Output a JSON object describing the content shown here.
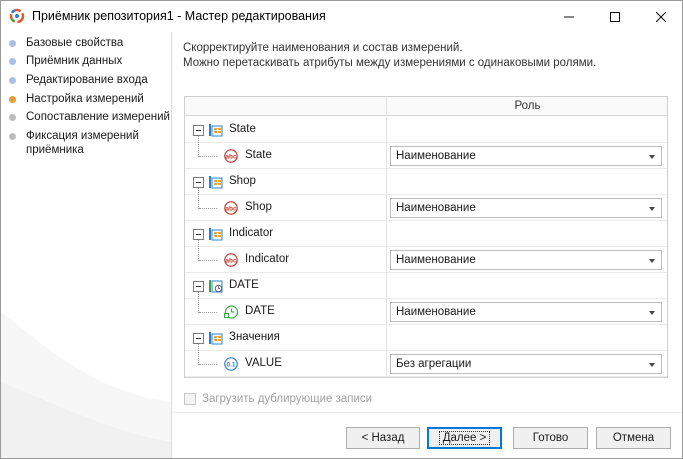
{
  "window": {
    "title": "Приёмник репозитория1 - Мастер редактирования"
  },
  "sidebar": {
    "steps": [
      {
        "label": "Базовые свойства",
        "state": "done"
      },
      {
        "label": "Приёмник данных",
        "state": "done"
      },
      {
        "label": "Редактирование входа",
        "state": "done"
      },
      {
        "label": "Настройка измерений",
        "state": "active"
      },
      {
        "label": "Сопоставление измерений",
        "state": "todo"
      },
      {
        "label": "Фиксация измерений приёмника",
        "state": "todo"
      }
    ]
  },
  "main": {
    "description_line1": "Скорректируйте наименования и состав измерений.",
    "description_line2": "Можно перетаскивать атрибуты между измерениями с одинаковыми ролями.",
    "grid": {
      "role_header": "Роль",
      "groups": [
        {
          "name": "State",
          "icon": "dimension-icon",
          "attribute": "State",
          "attribute_icon": "text-attribute-icon",
          "role": "Наименование"
        },
        {
          "name": "Shop",
          "icon": "dimension-icon",
          "attribute": "Shop",
          "attribute_icon": "text-attribute-icon",
          "role": "Наименование"
        },
        {
          "name": "Indicator",
          "icon": "dimension-icon",
          "attribute": "Indicator",
          "attribute_icon": "text-attribute-icon",
          "role": "Наименование"
        },
        {
          "name": "DATE",
          "icon": "calendar-dimension-icon",
          "attribute": "DATE",
          "attribute_icon": "date-attribute-icon",
          "role": "Наименование"
        },
        {
          "name": "Значения",
          "icon": "dimension-icon",
          "attribute": "VALUE",
          "attribute_icon": "numeric-attribute-icon",
          "role": "Без агрегации"
        }
      ]
    },
    "duplicate_checkbox_label": "Загрузить дублирующие записи",
    "duplicate_checkbox_checked": false
  },
  "buttons": {
    "back": "< Назад",
    "next": "Далее >",
    "finish": "Готово",
    "cancel": "Отмена"
  },
  "colors": {
    "step_done": "#a9bfe6",
    "step_active": "#e69a3a",
    "step_todo": "#bdbdbd",
    "default_button_border": "#0078d7"
  }
}
